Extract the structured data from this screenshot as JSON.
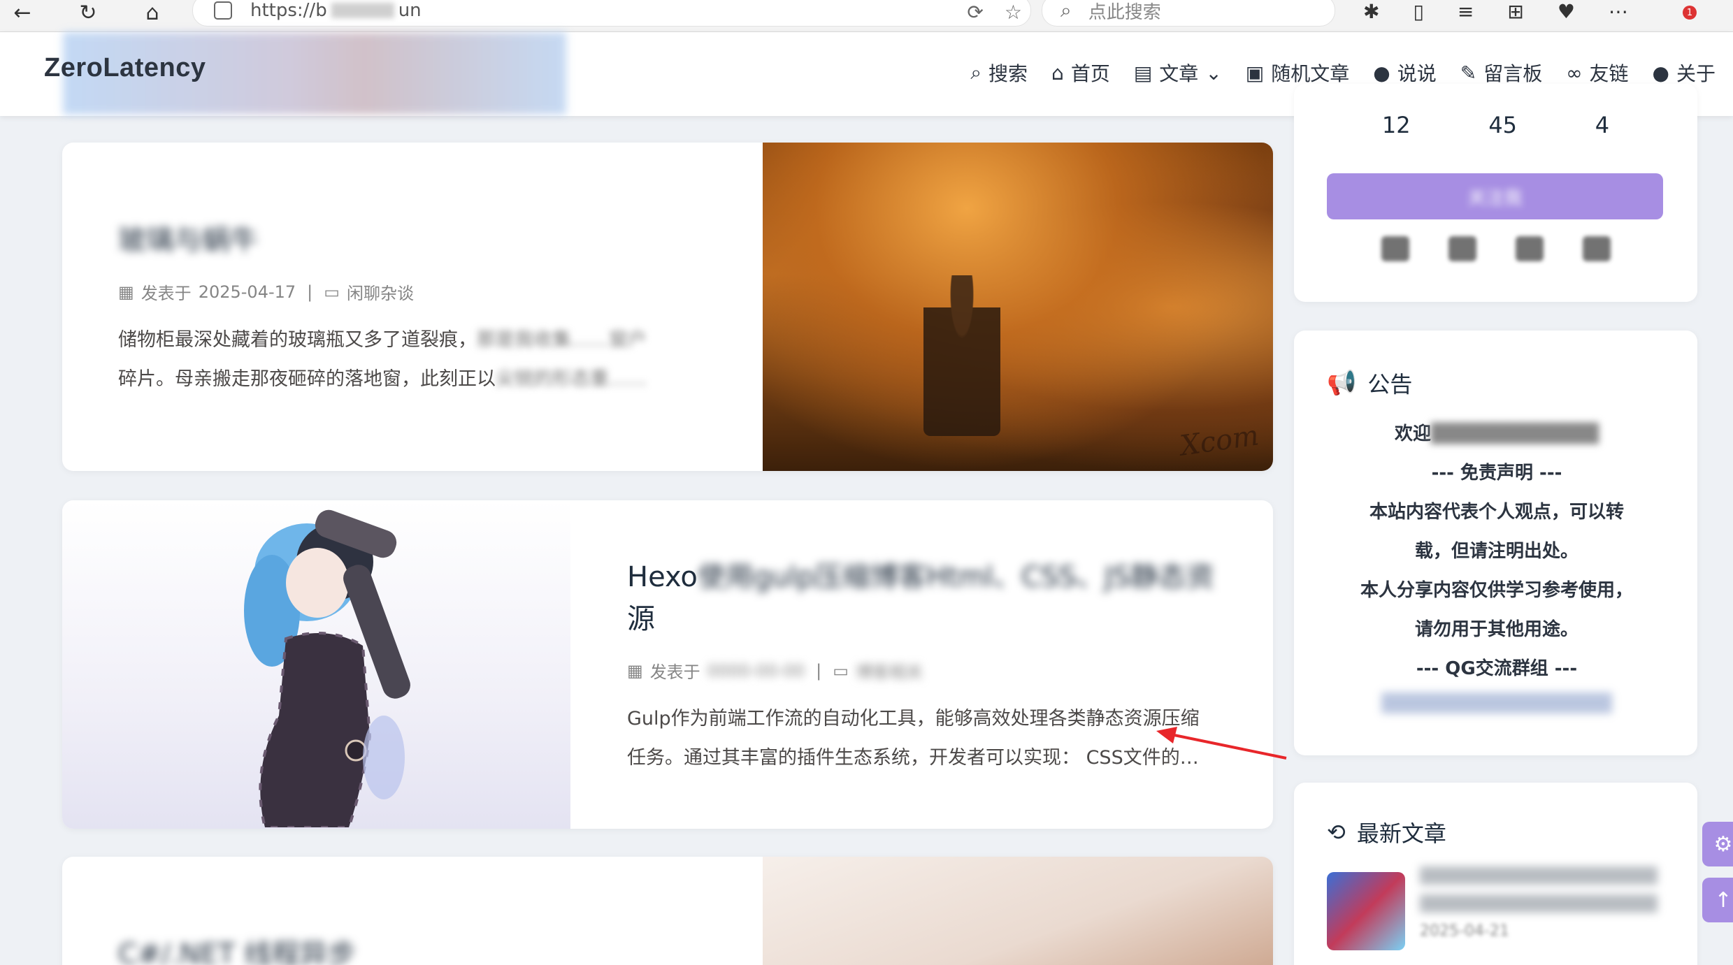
{
  "browser": {
    "url_prefix": "https://b",
    "url_suffix": "un",
    "search_placeholder": "点此搜索",
    "notification_count": "1"
  },
  "site": {
    "logo": "ZeroLatency",
    "nav": [
      {
        "label": "搜索",
        "icon": "search-icon"
      },
      {
        "label": "首页",
        "icon": "home-icon"
      },
      {
        "label": "文章",
        "icon": "archive-icon"
      },
      {
        "label": "随机文章",
        "icon": "bus-icon"
      },
      {
        "label": "说说",
        "icon": "comment-icon"
      },
      {
        "label": "留言板",
        "icon": "edit-icon"
      },
      {
        "label": "友链",
        "icon": "link-icon"
      },
      {
        "label": "关于",
        "icon": "user-icon"
      }
    ]
  },
  "posts": [
    {
      "title": "玻璃与蜗牛",
      "date_prefix": "发表于",
      "date": "2025-04-17",
      "category": "闲聊杂谈",
      "excerpt_line1": "储物柜最深处藏着的玻璃瓶又多了道裂痕，",
      "excerpt_line1_blur": "那是我收集……窗户",
      "excerpt_line2": "碎片。母亲搬走那夜砸碎的落地窗，此刻正以",
      "excerpt_line2_blur": "尖锐的形态重……"
    },
    {
      "title_visible_start": "Hexo",
      "title_blur": "使用gulp压缩博客Html、CSS、JS静态资",
      "title_end": "源",
      "date_prefix": "发表于",
      "category": "博客相关",
      "excerpt_line1": "Gulp作为前端工作流的自动化工具，能够高效处理各类静态资源压缩",
      "excerpt_line2": "任务。通过其丰富的插件生态系统，开发者可以实现： CSS文件的…"
    },
    {
      "title": "C#/.NET 线程异步"
    }
  ],
  "sidebar": {
    "stats": [
      "12",
      "45",
      "4"
    ],
    "follow_label": "关注我",
    "announce_title": "公告",
    "announce_lines": [
      "欢迎",
      "--- 免责声明 ---",
      "本站内容代表个人观点，可以转",
      "载，但请注明出处。",
      "本人分享内容仅供学习参考使用，",
      "请勿用于其他用途。",
      "--- QG交流群组 ---"
    ],
    "recent_title": "最新文章",
    "recent_date": "2025-04-21"
  },
  "colors": {
    "accent": "#a78ee3",
    "announce_icon": "#e53935",
    "annotation_arrow": "#e8262a"
  }
}
